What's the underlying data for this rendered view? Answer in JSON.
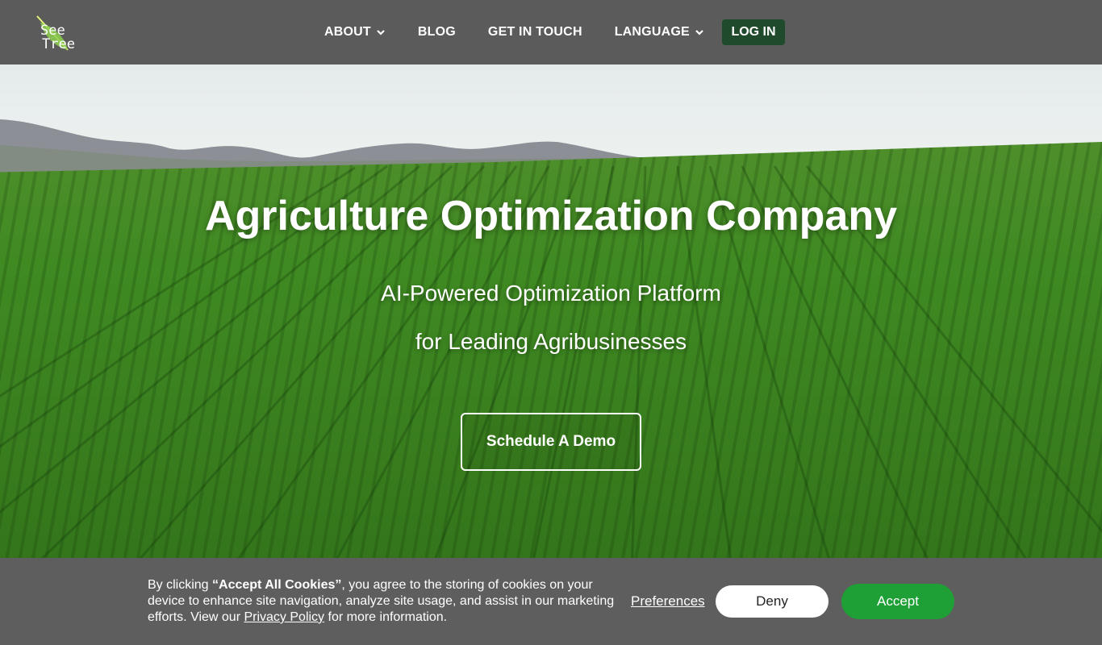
{
  "brand": {
    "logo_line1": "See",
    "logo_line2": "Tree"
  },
  "nav": {
    "items": [
      {
        "label": "ABOUT",
        "has_dropdown": true
      },
      {
        "label": "BLOG",
        "has_dropdown": false
      },
      {
        "label": "GET IN TOUCH",
        "has_dropdown": false
      },
      {
        "label": "LANGUAGE",
        "has_dropdown": true
      }
    ],
    "login_label": "LOG IN"
  },
  "hero": {
    "title": "Agriculture Optimization Company",
    "subtitle_line1": "AI-Powered Optimization Platform",
    "subtitle_line2": "for Leading Agribusinesses",
    "cta_label": "Schedule A Demo"
  },
  "cookie_banner": {
    "text_prefix": "By clicking ",
    "text_bold": "“Accept All Cookies”",
    "text_middle": ", you agree to the storing of cookies on your device to enhance site navigation, analyze site usage, and assist in our marketing efforts. View our ",
    "privacy_link": "Privacy Policy",
    "text_suffix": " for more information.",
    "preferences_label": "Preferences",
    "deny_label": "Deny",
    "accept_label": "Accept"
  },
  "colors": {
    "navbar_bg": "#5b5b5b",
    "login_bg": "#1f4a2c",
    "accept_bg": "#1fa036",
    "cookie_bg": "#5e5e5e"
  },
  "icons": [
    "chevron-down-icon",
    "leaf-logo-icon"
  ]
}
